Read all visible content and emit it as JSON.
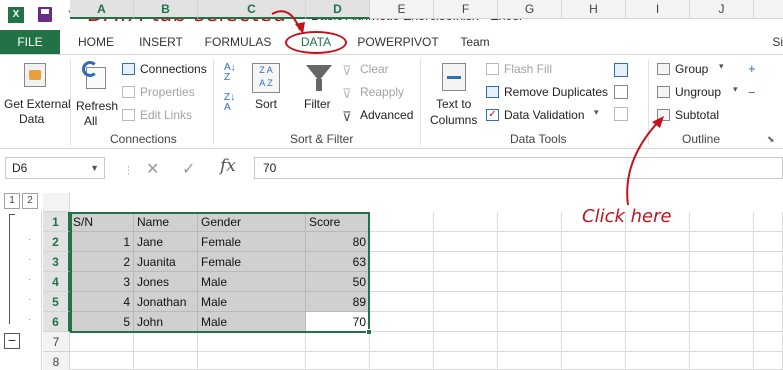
{
  "title": "Basic Aithmetic Exercise.xlsx - Excel",
  "annotations": {
    "top": "DATA tab selected",
    "bottom": "Click here"
  },
  "window": {
    "help": "?",
    "restore": "⧉",
    "minimize": "—",
    "maximize": "☐"
  },
  "tabs": [
    "FILE",
    "HOME",
    "INSERT",
    "FORMULAS",
    "DATA",
    "POWERPIVOT",
    "Team"
  ],
  "signin": "Si",
  "ribbon": {
    "get_external_data": "Get External Data",
    "get_external_data_line1": "Get External",
    "get_external_data_line2": "Data",
    "refresh_all_line1": "Refresh",
    "refresh_all_line2": "All",
    "connections_btn": "Connections",
    "properties_btn": "Properties",
    "edit_links_btn": "Edit Links",
    "group_connections": "Connections",
    "sort": "Sort",
    "filter": "Filter",
    "clear": "Clear",
    "reapply": "Reapply",
    "advanced": "Advanced",
    "group_sort_filter": "Sort & Filter",
    "text_to_columns_line1": "Text to",
    "text_to_columns_line2": "Columns",
    "flash_fill": "Flash Fill",
    "remove_duplicates": "Remove Duplicates",
    "data_validation": "Data Validation",
    "group_data_tools": "Data Tools",
    "group_btn": "Group",
    "ungroup_btn": "Ungroup",
    "subtotal_btn": "Subtotal",
    "group_outline": "Outline"
  },
  "formula_bar": {
    "name_box": "D6",
    "cancel": "✕",
    "enter": "✓",
    "fx": "fx",
    "value": "70"
  },
  "grid": {
    "outline_levels": [
      "1",
      "2"
    ],
    "columns": [
      "A",
      "B",
      "C",
      "D",
      "E",
      "F",
      "G",
      "H",
      "I",
      "J"
    ],
    "rows": [
      "1",
      "2",
      "3",
      "4",
      "5",
      "6",
      "7",
      "8"
    ],
    "header_row": [
      "S/N",
      "Name",
      "Gender",
      "Score"
    ],
    "data_rows": [
      [
        "1",
        "Jane",
        "Female",
        "80"
      ],
      [
        "2",
        "Juanita",
        "Female",
        "63"
      ],
      [
        "3",
        "Jones",
        "Male",
        "50"
      ],
      [
        "4",
        "Jonathan",
        "Male",
        "89"
      ],
      [
        "5",
        "John",
        "Male",
        "70"
      ]
    ],
    "outline_collapse": "−"
  }
}
